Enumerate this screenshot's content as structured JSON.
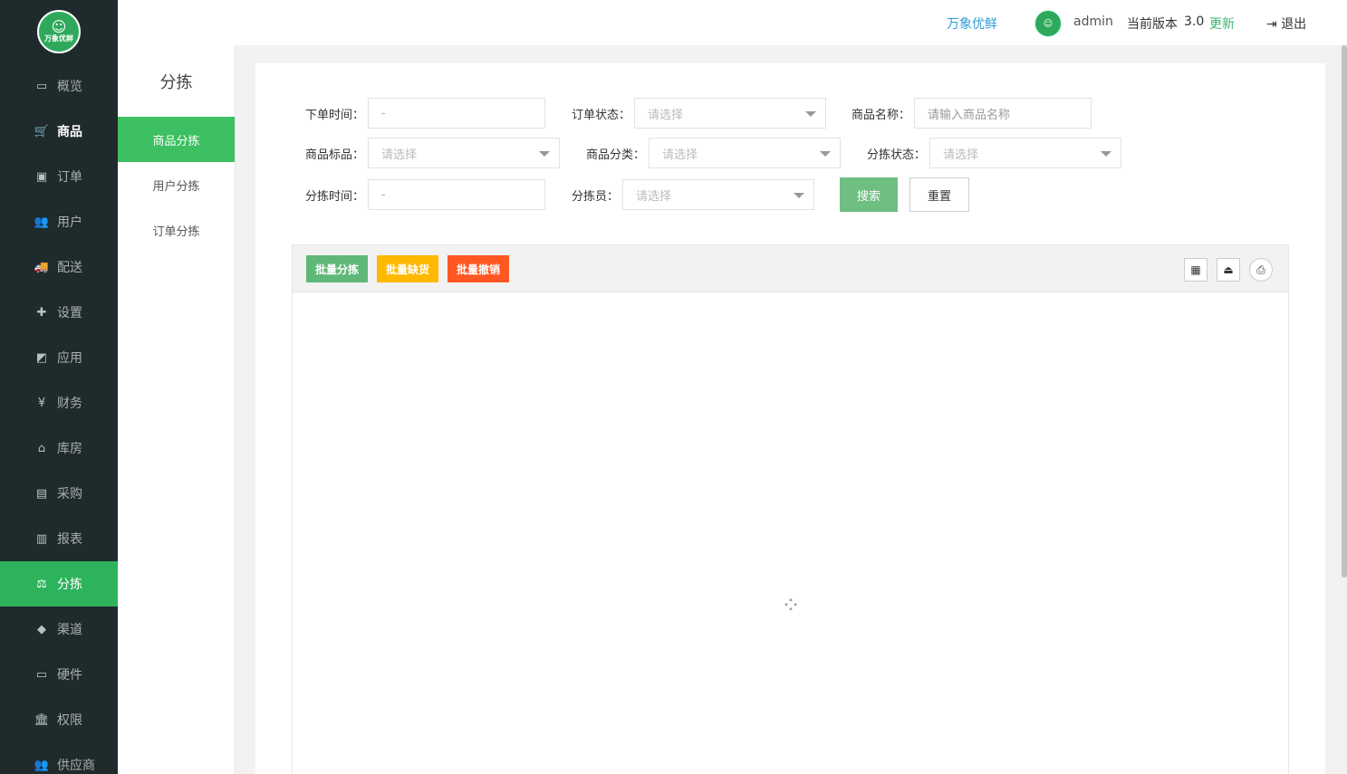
{
  "logo": {
    "brand": "万象优鲜",
    "glyph": "☺"
  },
  "sidebar": {
    "items": [
      {
        "label": "概览",
        "icon": "▭"
      },
      {
        "label": "商品",
        "icon": "🛒"
      },
      {
        "label": "订单",
        "icon": "▣"
      },
      {
        "label": "用户",
        "icon": "👥"
      },
      {
        "label": "配送",
        "icon": "🚚"
      },
      {
        "label": "设置",
        "icon": "✚"
      },
      {
        "label": "应用",
        "icon": "◩"
      },
      {
        "label": "财务",
        "icon": "¥"
      },
      {
        "label": "库房",
        "icon": "⌂"
      },
      {
        "label": "采购",
        "icon": "▤"
      },
      {
        "label": "报表",
        "icon": "▥"
      },
      {
        "label": "分拣",
        "icon": "⚖"
      },
      {
        "label": "渠道",
        "icon": "◆"
      },
      {
        "label": "硬件",
        "icon": "▭"
      },
      {
        "label": "权限",
        "icon": "🏛"
      },
      {
        "label": "供应商",
        "icon": "👥"
      }
    ]
  },
  "subnav": {
    "title": "分拣",
    "items": [
      {
        "label": "商品分拣"
      },
      {
        "label": "用户分拣"
      },
      {
        "label": "订单分拣"
      }
    ]
  },
  "topbar": {
    "shop": "万象优鲜",
    "user": "admin",
    "version_label": "当前版本",
    "version": "3.0",
    "update": "更新",
    "logout": "退出",
    "logout_icon": "⇥"
  },
  "filters": {
    "order_time": {
      "label": "下单时间：",
      "value": "-"
    },
    "order_status": {
      "label": "订单状态：",
      "placeholder": "请选择"
    },
    "product_name": {
      "label": "商品名称：",
      "placeholder": "请输入商品名称"
    },
    "product_tag": {
      "label": "商品标品：",
      "placeholder": "请选择"
    },
    "product_category": {
      "label": "商品分类：",
      "placeholder": "请选择"
    },
    "sort_status": {
      "label": "分拣状态：",
      "placeholder": "请选择"
    },
    "sort_time": {
      "label": "分拣时间：",
      "value": "-"
    },
    "sorter": {
      "label": "分拣员：",
      "placeholder": "请选择"
    },
    "search": "搜索",
    "reset": "重置"
  },
  "toolbar": {
    "batch_sort": "批量分拣",
    "batch_shortage": "批量缺货",
    "batch_cancel": "批量撤销",
    "icons": {
      "columns": "▦",
      "export": "⏏",
      "print": "⎙"
    }
  },
  "loading": "⁘"
}
